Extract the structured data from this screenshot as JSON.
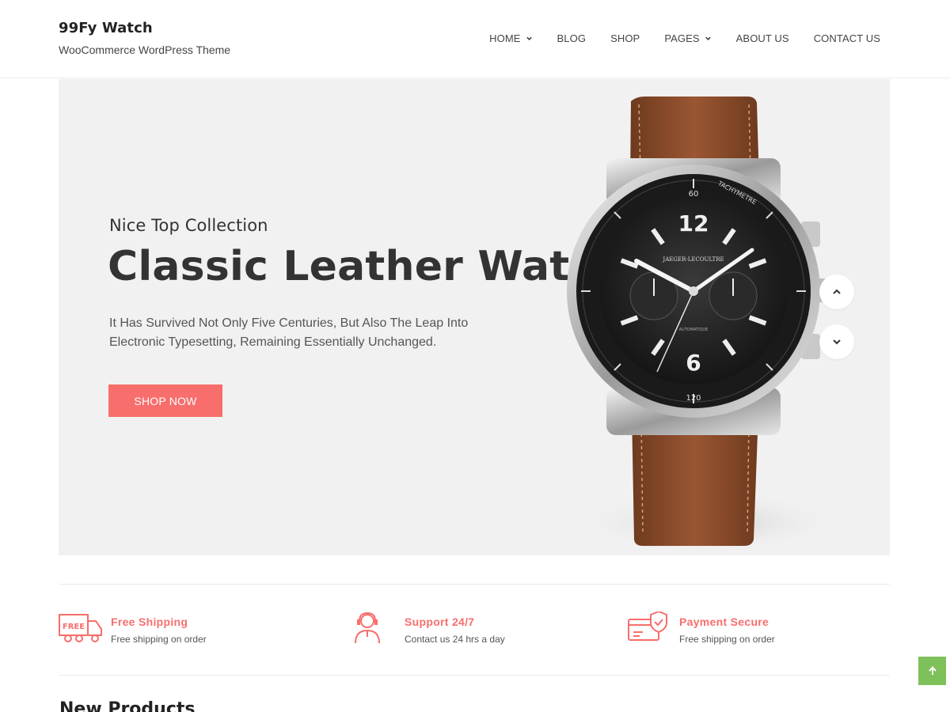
{
  "header": {
    "site_title": "99Fy Watch",
    "tagline": "WooCommerce WordPress Theme"
  },
  "nav": {
    "items": [
      {
        "label": "HOME",
        "has_dropdown": true
      },
      {
        "label": "BLOG",
        "has_dropdown": false
      },
      {
        "label": "SHOP",
        "has_dropdown": false
      },
      {
        "label": "PAGES",
        "has_dropdown": true
      },
      {
        "label": "ABOUT US",
        "has_dropdown": false
      },
      {
        "label": "CONTACT US",
        "has_dropdown": false
      }
    ]
  },
  "hero": {
    "eyebrow": "Nice Top Collection",
    "title": "Classic Leather Watch",
    "description": "It Has Survived Not Only Five Centuries, But Also The Leap Into Electronic Typesetting, Remaining Essentially Unchanged.",
    "button_label": "SHOP NOW",
    "image": "leather-watch-image",
    "dial_numbers": {
      "top": "12",
      "bottom": "6",
      "bezel_top": "60",
      "bezel_bottom": "120",
      "bezel_label": "TACHYMETRE",
      "brand": "JAEGER-LECOULTRE",
      "automatic": "AUTOMATIQUE"
    }
  },
  "features": [
    {
      "title": "Free Shipping",
      "subtitle": "Free shipping on order",
      "icon": "truck-free-icon",
      "icon_text": "FREE"
    },
    {
      "title": "Support 24/7",
      "subtitle": "Contact us 24 hrs a day",
      "icon": "support-agent-icon"
    },
    {
      "title": "Payment Secure",
      "subtitle": "Free shipping on order",
      "icon": "secure-payment-icon"
    }
  ],
  "sections": {
    "new_products_title": "New Products"
  },
  "colors": {
    "accent": "#f76e6c",
    "hero_bg": "#f1f1f1",
    "back_to_top": "#7ec15a",
    "strap": "#8b4a2b"
  }
}
